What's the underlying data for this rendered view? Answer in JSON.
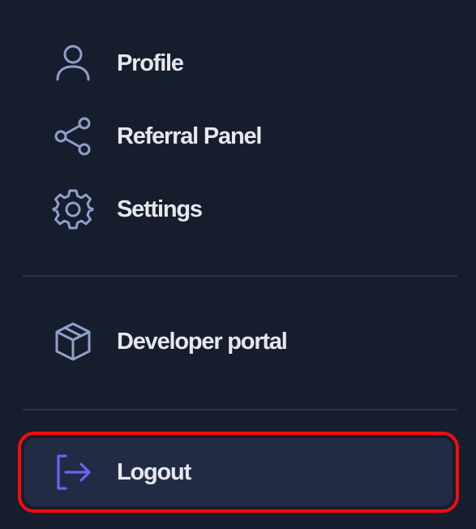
{
  "menu": {
    "items": [
      {
        "label": "Profile",
        "icon": "user-icon"
      },
      {
        "label": "Referral Panel",
        "icon": "share-icon"
      },
      {
        "label": "Settings",
        "icon": "gear-icon"
      },
      {
        "label": "Developer portal",
        "icon": "cube-icon"
      }
    ],
    "logout": {
      "label": "Logout",
      "icon": "logout-icon"
    }
  },
  "colors": {
    "background": "#161d2d",
    "icon": "#8fa0c8",
    "logout_icon": "#6c63f0",
    "highlight_border": "#f40b10",
    "logout_background": "#212b43"
  }
}
